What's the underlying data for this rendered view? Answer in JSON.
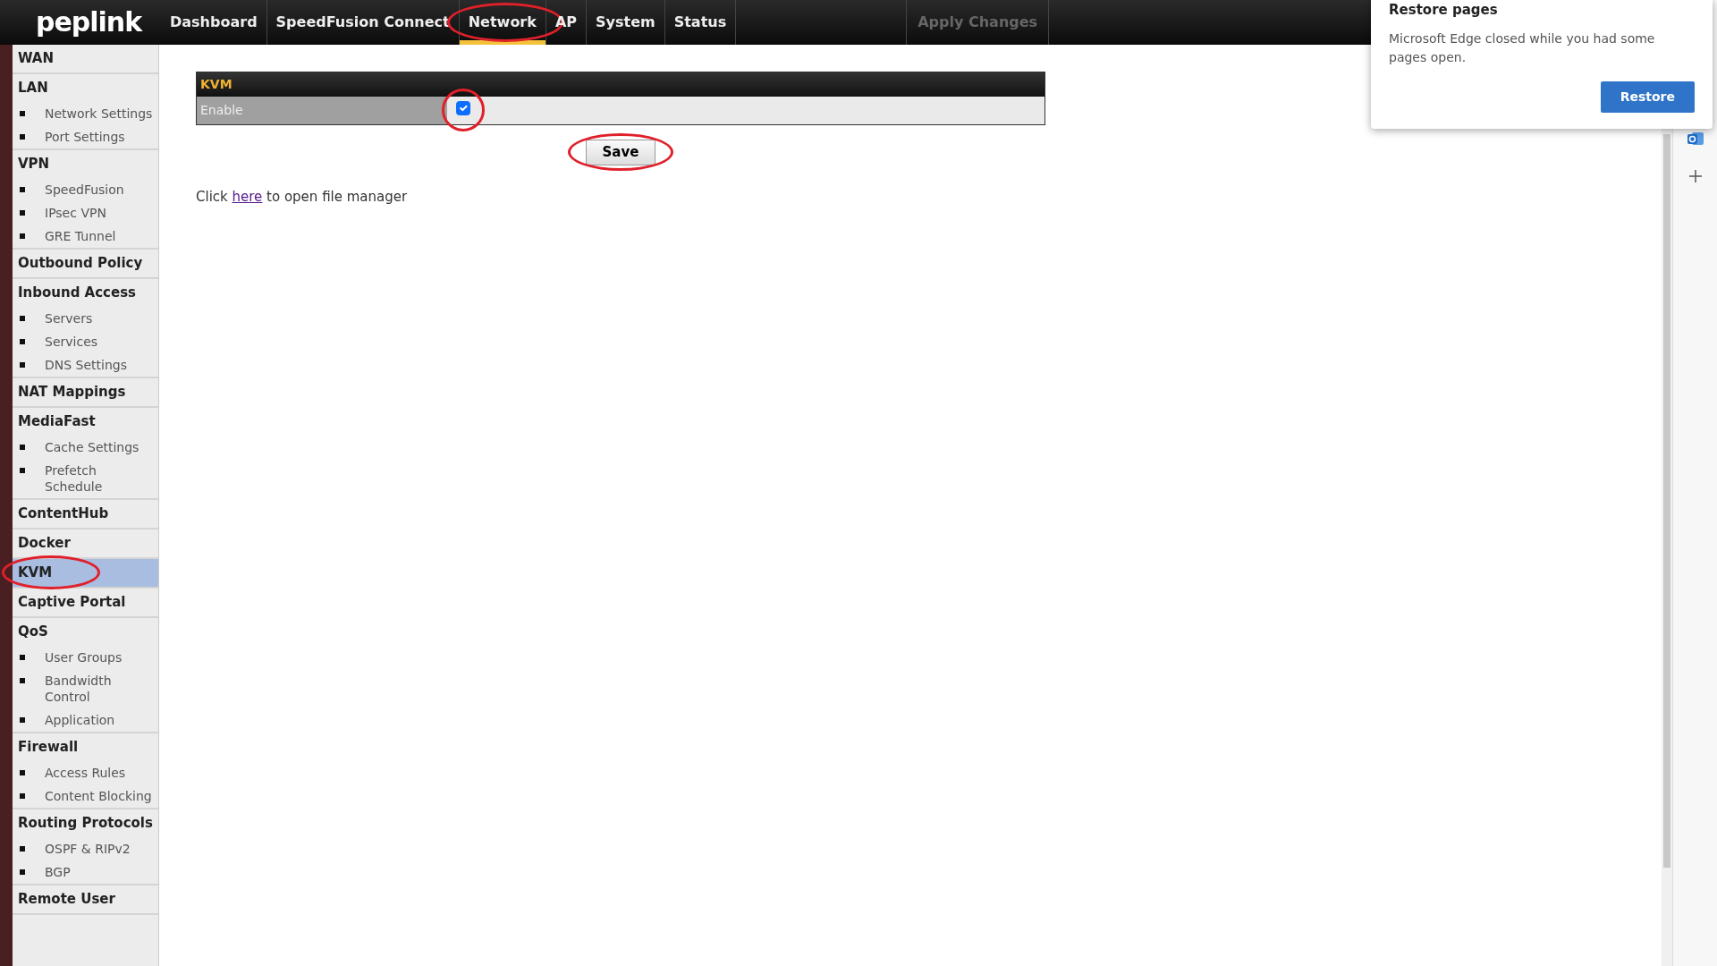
{
  "nav": {
    "logo": "peplink",
    "tabs": [
      {
        "label": "Dashboard",
        "selected": false
      },
      {
        "label": "SpeedFusion Connect",
        "selected": false
      },
      {
        "label": "Network",
        "selected": true
      },
      {
        "label": "AP",
        "selected": false
      },
      {
        "label": "System",
        "selected": false
      },
      {
        "label": "Status",
        "selected": false
      }
    ],
    "apply": {
      "label": "Apply Changes",
      "disabled": true
    }
  },
  "sidebar": {
    "sections": [
      {
        "label": "WAN",
        "selected": false
      },
      {
        "label": "LAN",
        "selected": false,
        "children": [
          {
            "label": "Network Settings"
          },
          {
            "label": "Port Settings"
          }
        ]
      },
      {
        "label": "VPN",
        "selected": false,
        "children": [
          {
            "label": "SpeedFusion"
          },
          {
            "label": "IPsec VPN"
          },
          {
            "label": "GRE Tunnel"
          }
        ]
      },
      {
        "label": "Outbound Policy",
        "selected": false
      },
      {
        "label": "Inbound Access",
        "selected": false,
        "children": [
          {
            "label": "Servers"
          },
          {
            "label": "Services"
          },
          {
            "label": "DNS Settings"
          }
        ]
      },
      {
        "label": "NAT Mappings",
        "selected": false
      },
      {
        "label": "MediaFast",
        "selected": false,
        "children": [
          {
            "label": "Cache Settings"
          },
          {
            "label": "Prefetch Schedule"
          }
        ]
      },
      {
        "label": "ContentHub",
        "selected": false
      },
      {
        "label": "Docker",
        "selected": false
      },
      {
        "label": "KVM",
        "selected": true
      },
      {
        "label": "Captive Portal",
        "selected": false
      },
      {
        "label": "QoS",
        "selected": false,
        "children": [
          {
            "label": "User Groups"
          },
          {
            "label": "Bandwidth Control"
          },
          {
            "label": "Application"
          }
        ]
      },
      {
        "label": "Firewall",
        "selected": false,
        "children": [
          {
            "label": "Access Rules"
          },
          {
            "label": "Content Blocking"
          }
        ]
      },
      {
        "label": "Routing Protocols",
        "selected": false,
        "children": [
          {
            "label": "OSPF & RIPv2"
          },
          {
            "label": "BGP"
          }
        ]
      },
      {
        "label": "Remote User",
        "selected": false
      }
    ]
  },
  "panel": {
    "title": "KVM",
    "rows": [
      {
        "label": "Enable",
        "checked": true
      }
    ]
  },
  "save": "Save",
  "file_manager": {
    "before": "Click",
    "link": "here",
    "after": "to open file manager"
  },
  "popup": {
    "title": "Restore pages",
    "message": "Microsoft Edge closed while you had some pages open.",
    "button": "Restore"
  }
}
